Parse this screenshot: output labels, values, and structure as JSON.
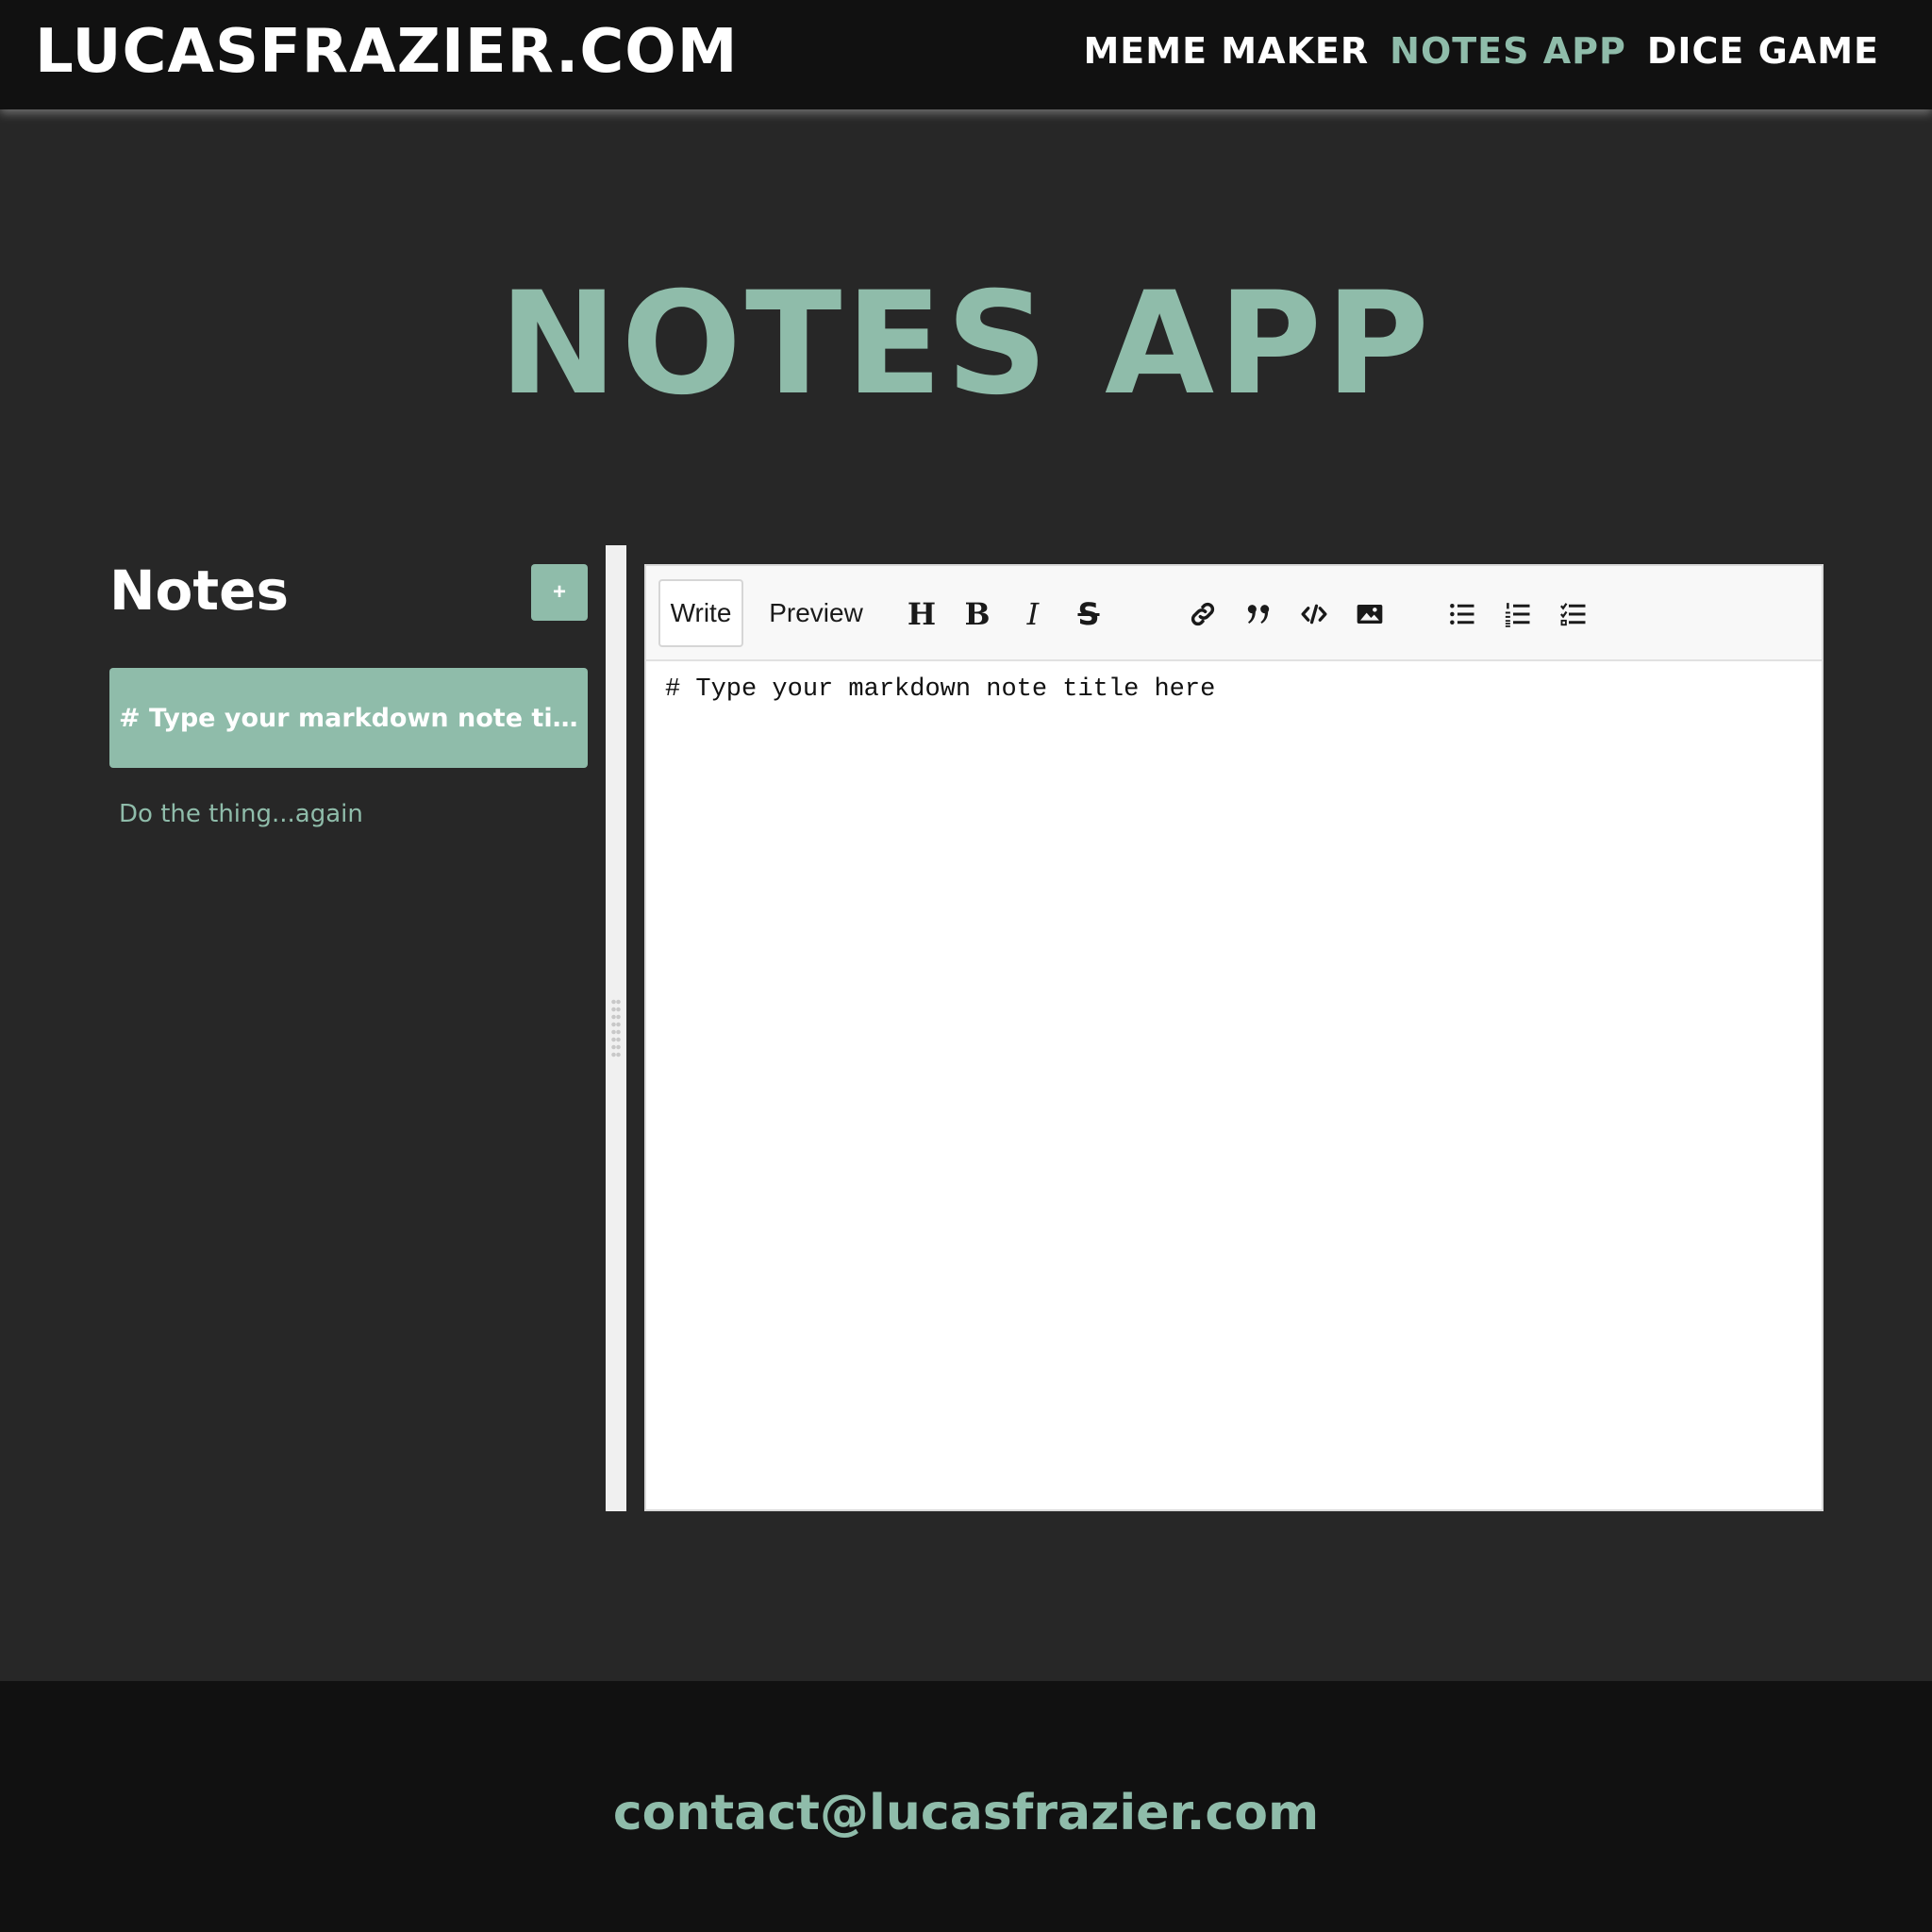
{
  "header": {
    "brand": "LUCASFRAZIER.COM",
    "nav": [
      {
        "label": "MEME MAKER",
        "active": false
      },
      {
        "label": "NOTES APP",
        "active": true
      },
      {
        "label": "DICE GAME",
        "active": false
      }
    ]
  },
  "main": {
    "title": "NOTES APP"
  },
  "sidebar": {
    "title": "Notes",
    "add_label": "+",
    "notes": [
      {
        "label": "# Type your markdown note title here",
        "selected": true
      },
      {
        "label": "Do the thing...again",
        "selected": false
      }
    ]
  },
  "editor": {
    "tabs": {
      "write": "Write",
      "preview": "Preview"
    },
    "active_tab": "Write",
    "toolbar_icons": [
      "heading-icon",
      "bold-icon",
      "italic-icon",
      "strikethrough-icon",
      "link-icon",
      "quote-icon",
      "code-icon",
      "image-icon",
      "unordered-list-icon",
      "ordered-list-icon",
      "checked-list-icon"
    ],
    "toolbar_glyphs": {
      "heading": "H",
      "bold": "B",
      "italic": "I",
      "strike": "S"
    },
    "content": "# Type your markdown note title here"
  },
  "footer": {
    "email": "contact@lucasfrazier.com"
  },
  "colors": {
    "accent": "#8fbcaa",
    "page_background": "#272727",
    "bar_background": "#111111"
  }
}
